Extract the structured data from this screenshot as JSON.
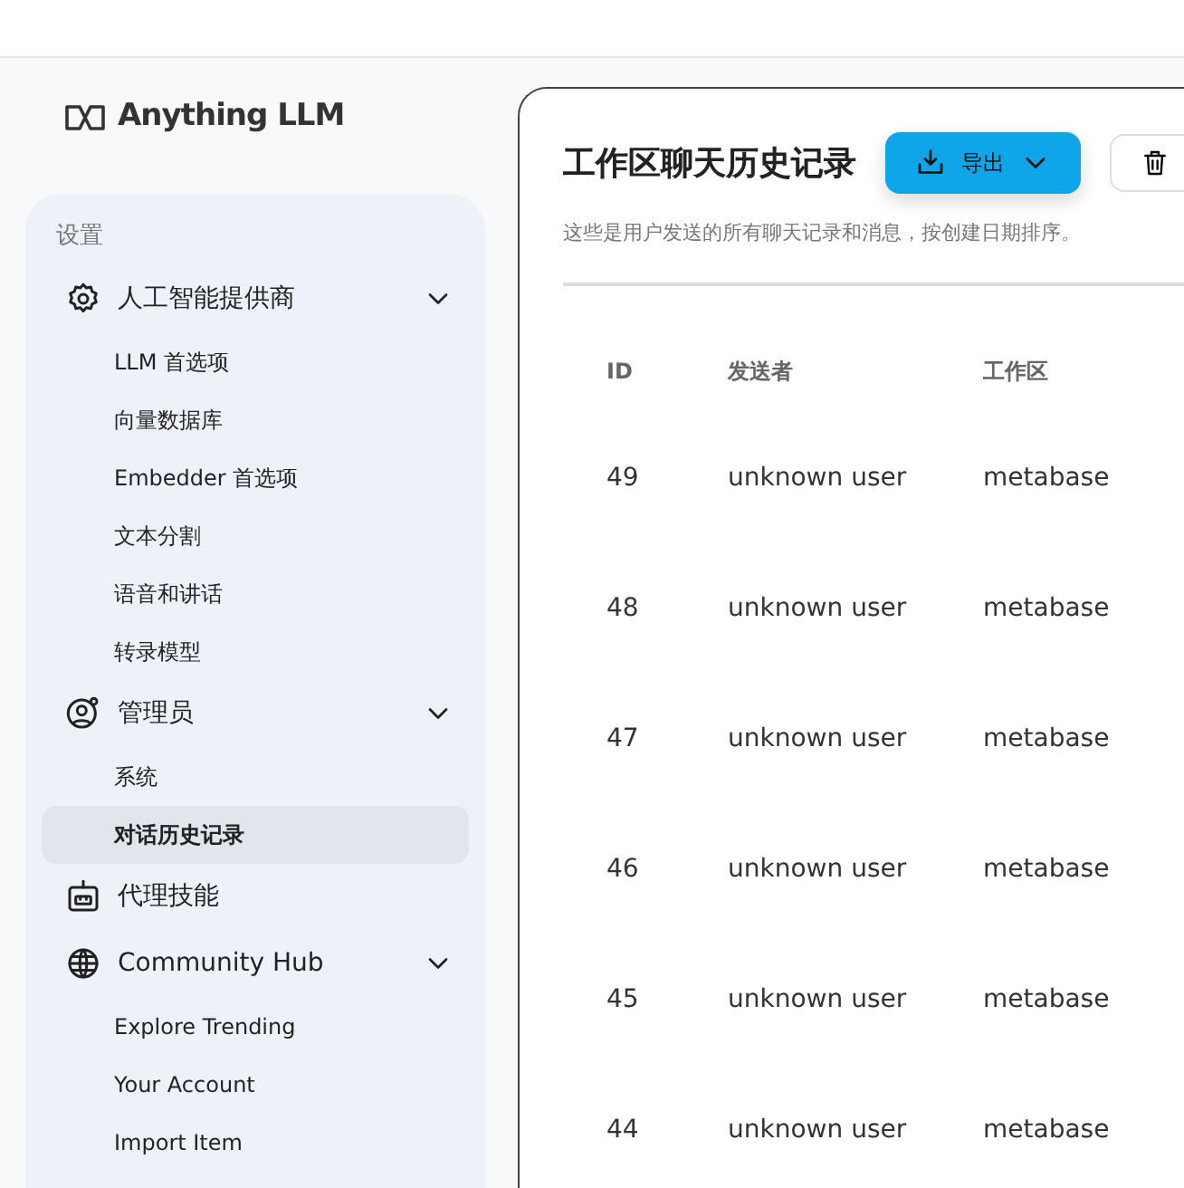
{
  "logo": {
    "text": "Anything LLM"
  },
  "sidebar": {
    "section_label": "设置",
    "items": [
      {
        "kind": "group",
        "label": "人工智能提供商",
        "expanded": true,
        "children": [
          {
            "label": "LLM 首选项",
            "selected": false
          },
          {
            "label": "向量数据库",
            "selected": false
          },
          {
            "label": "Embedder 首选项",
            "selected": false
          },
          {
            "label": "文本分割",
            "selected": false
          },
          {
            "label": "语音和讲话",
            "selected": false
          },
          {
            "label": "转录模型",
            "selected": false
          }
        ]
      },
      {
        "kind": "group",
        "label": "管理员",
        "expanded": true,
        "children": [
          {
            "label": "系统",
            "selected": false
          },
          {
            "label": "对话历史记录",
            "selected": true
          }
        ]
      },
      {
        "kind": "link",
        "label": "代理技能"
      },
      {
        "kind": "group",
        "label": "Community Hub",
        "expanded": true,
        "children": [
          {
            "label": "Explore Trending",
            "selected": false
          },
          {
            "label": "Your Account",
            "selected": false
          },
          {
            "label": "Import Item",
            "selected": false
          }
        ]
      }
    ]
  },
  "main": {
    "title": "工作区聊天历史记录",
    "export_button": "导出",
    "description": "这些是用户发送的所有聊天记录和消息，按创建日期排序。",
    "table": {
      "columns": [
        "ID",
        "发送者",
        "工作区"
      ],
      "rows": [
        [
          "49",
          "unknown user",
          "metabase"
        ],
        [
          "48",
          "unknown user",
          "metabase"
        ],
        [
          "47",
          "unknown user",
          "metabase"
        ],
        [
          "46",
          "unknown user",
          "metabase"
        ],
        [
          "45",
          "unknown user",
          "metabase"
        ],
        [
          "44",
          "unknown user",
          "metabase"
        ]
      ]
    }
  }
}
